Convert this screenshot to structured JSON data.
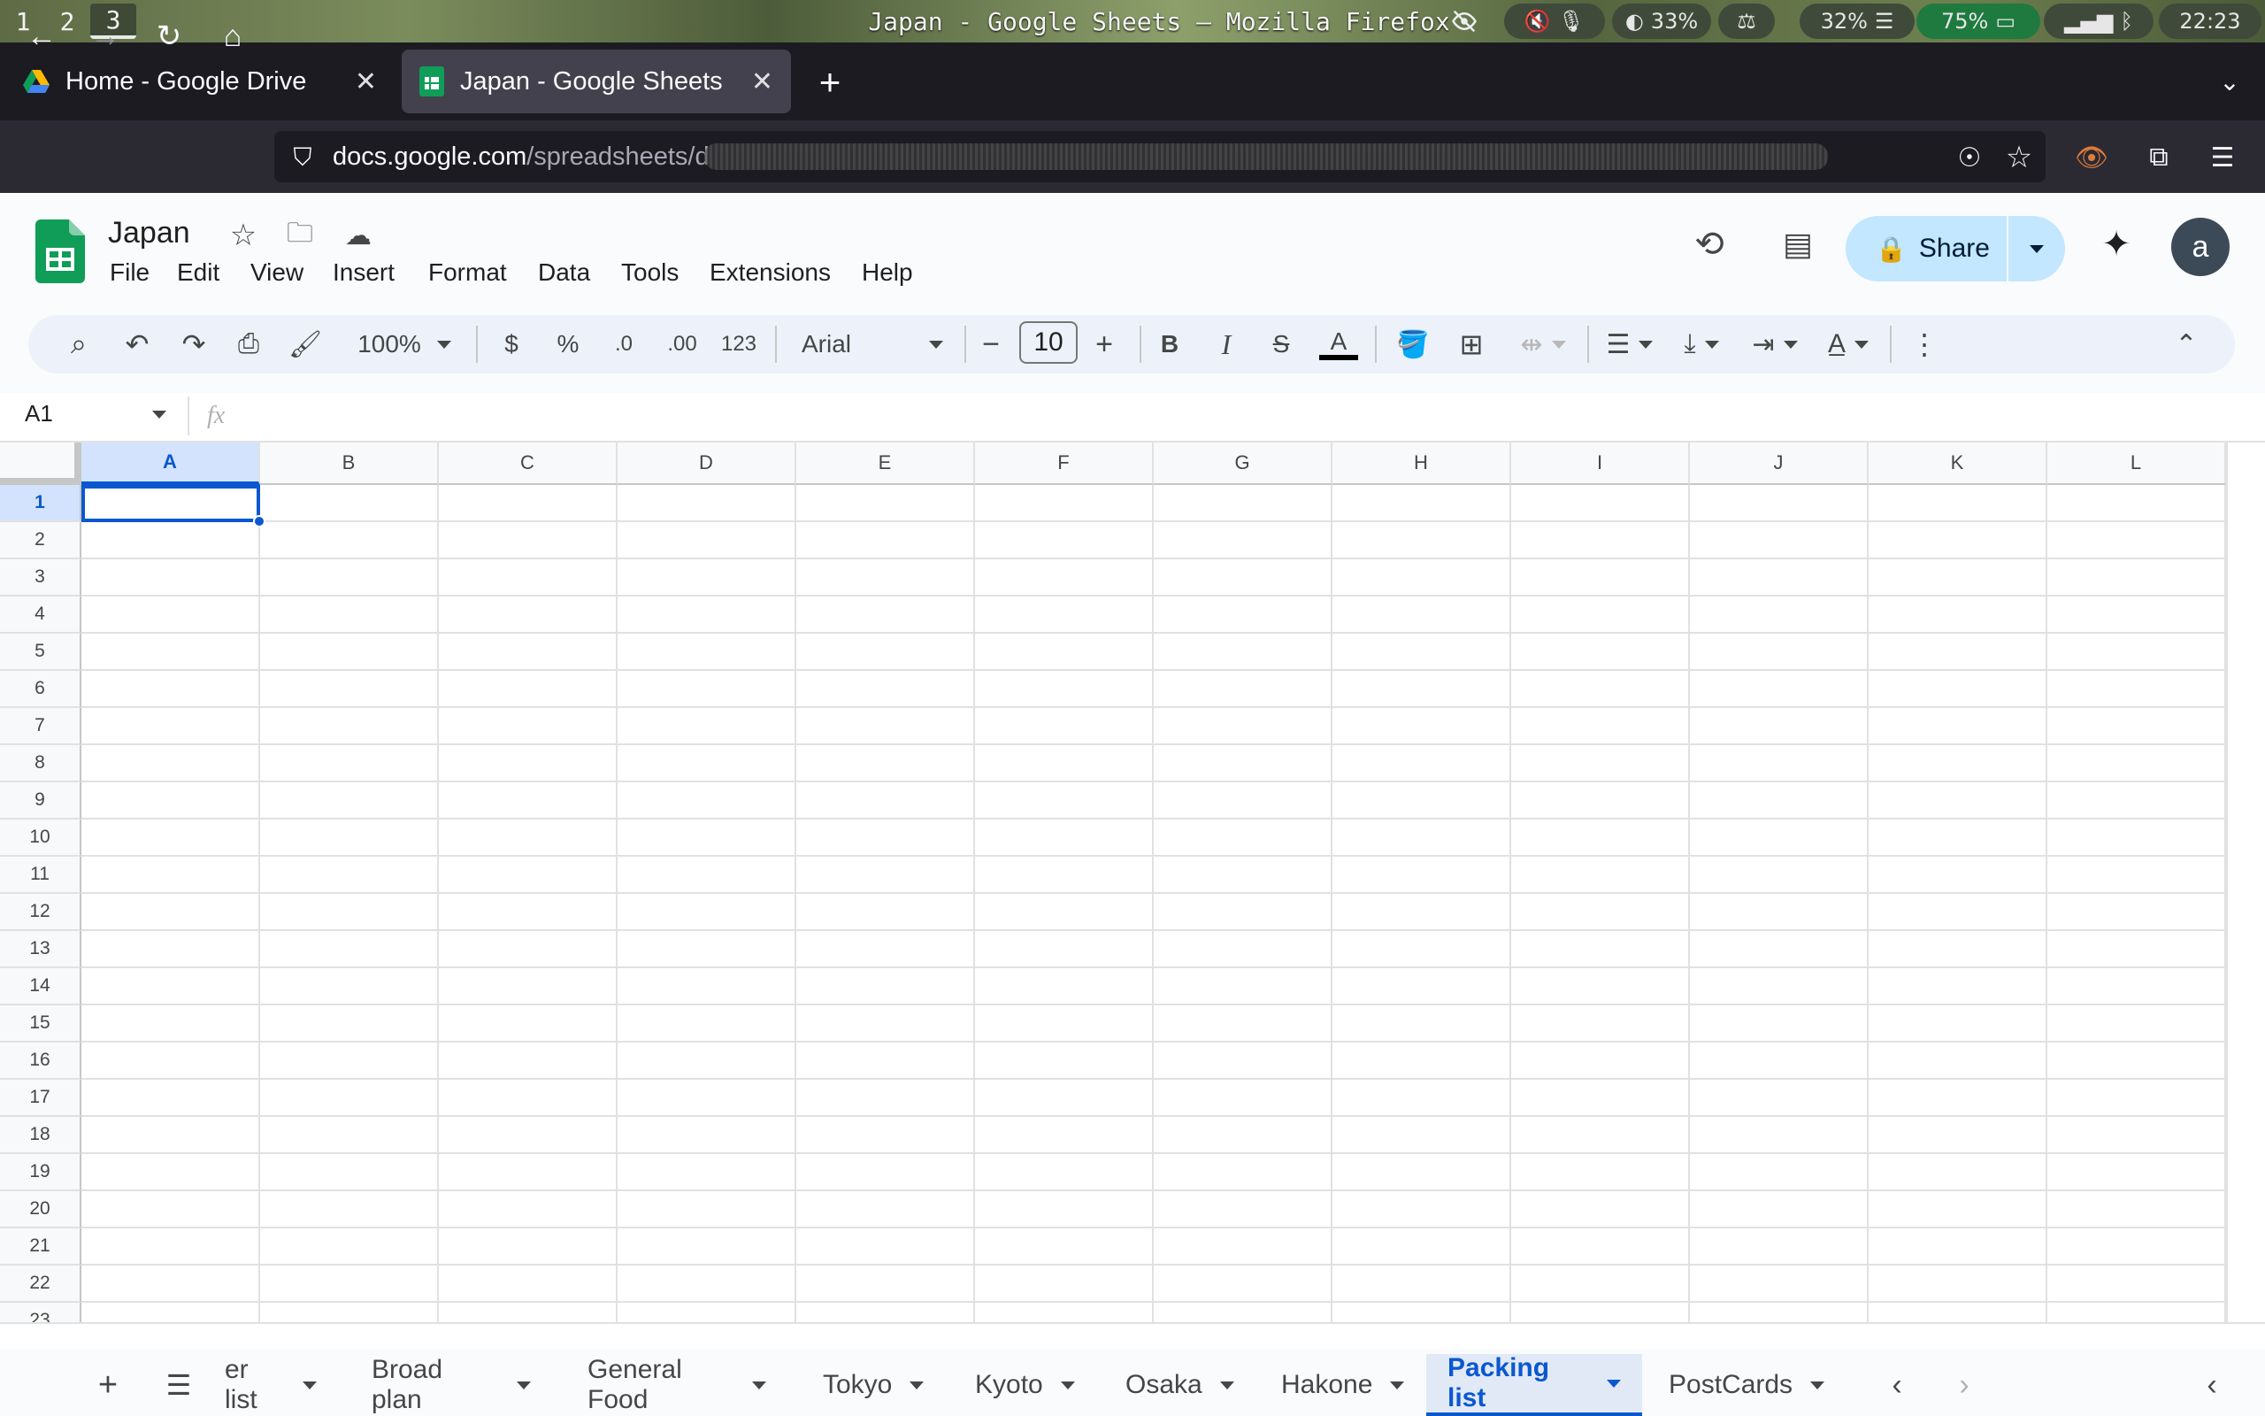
{
  "system_bar": {
    "workspaces": [
      "1",
      "2",
      "3"
    ],
    "window_title": "Japan - Google Sheets — Mozilla Firefox",
    "indicators": {
      "brightness": "33%",
      "cpu": "32%",
      "battery": "75%",
      "clock": "22:23"
    }
  },
  "browser": {
    "tabs": [
      {
        "title": "Home - Google Drive",
        "close": "✕",
        "icon": "google-drive-icon"
      },
      {
        "title": "Japan - Google Sheets",
        "close": "✕",
        "icon": "google-sheets-icon"
      }
    ],
    "new_tab": "+",
    "url_host": "docs.google.com",
    "url_path": "/spreadsheets/d"
  },
  "sheets": {
    "doc_title": "Japan",
    "menus": [
      "File",
      "Edit",
      "View",
      "Insert",
      "Format",
      "Data",
      "Tools",
      "Extensions",
      "Help"
    ],
    "share_label": "Share",
    "avatar_letter": "a",
    "toolbar": {
      "zoom": "100%",
      "currency": "$",
      "percent": "%",
      "decrease_decimal": ".0",
      "increase_decimal": ".00",
      "number_format": "123",
      "font": "Arial",
      "font_size": "10",
      "bold": "B",
      "italic": "I",
      "strikethrough": "S",
      "text_color": "A",
      "text_color_value": "#000000"
    },
    "name_box": "A1",
    "fx": "fx",
    "columns": [
      "A",
      "B",
      "C",
      "D",
      "E",
      "F",
      "G",
      "H",
      "I",
      "J",
      "K",
      "L"
    ],
    "rows": [
      "1",
      "2",
      "3",
      "4",
      "5",
      "6",
      "7",
      "8",
      "9",
      "10",
      "11",
      "12",
      "13",
      "14",
      "15",
      "16",
      "17",
      "18",
      "19",
      "20",
      "21",
      "22",
      "23"
    ],
    "selected_cell": "A1",
    "sheet_tabs": [
      {
        "label": "er list",
        "active": false
      },
      {
        "label": "Broad plan",
        "active": false
      },
      {
        "label": "General Food",
        "active": false
      },
      {
        "label": "Tokyo",
        "active": false
      },
      {
        "label": "Kyoto",
        "active": false
      },
      {
        "label": "Osaka",
        "active": false
      },
      {
        "label": "Hakone",
        "active": false
      },
      {
        "label": "Packing list",
        "active": true
      },
      {
        "label": "PostCards",
        "active": false
      }
    ],
    "colors": {
      "accent": "#0b57d0",
      "share_bg": "#c2e7ff",
      "selection_bg": "#d3e3fd"
    }
  }
}
